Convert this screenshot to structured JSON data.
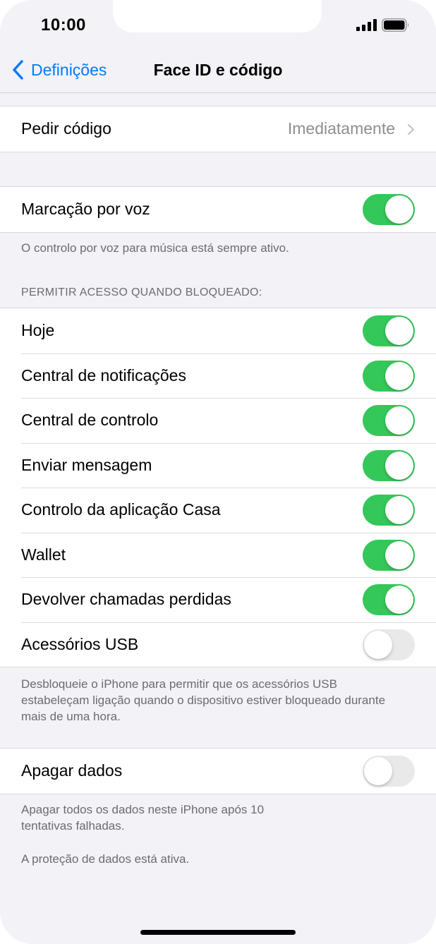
{
  "status": {
    "time": "10:00"
  },
  "nav": {
    "back_label": "Definições",
    "title": "Face ID e código"
  },
  "passcode": {
    "label": "Pedir código",
    "value": "Imediatamente"
  },
  "voice": {
    "label": "Marcação por voz",
    "enabled": true,
    "note": "O controlo por voz para música está sempre ativo."
  },
  "locked_access": {
    "header": "PERMITIR ACESSO QUANDO BLOQUEADO:",
    "items": [
      {
        "label": "Hoje",
        "enabled": true
      },
      {
        "label": "Central de notificações",
        "enabled": true
      },
      {
        "label": "Central de controlo",
        "enabled": true
      },
      {
        "label": "Enviar mensagem",
        "enabled": true
      },
      {
        "label": "Controlo da aplicação Casa",
        "enabled": true
      },
      {
        "label": "Wallet",
        "enabled": true
      },
      {
        "label": "Devolver chamadas perdidas",
        "enabled": true
      },
      {
        "label": "Acessórios USB",
        "enabled": false
      }
    ],
    "note": "Desbloqueie o iPhone para permitir que os acessórios USB estabeleçam ligação quando o dispositivo estiver bloqueado durante mais de uma hora."
  },
  "erase": {
    "label": "Apagar dados",
    "enabled": false,
    "note": "Apagar todos os dados neste iPhone após 10 tentativas falhadas.",
    "note2": "A proteção de dados está ativa."
  },
  "colors": {
    "accent": "#007aff",
    "switch_on": "#34c759",
    "switch_off": "#e9e9ea",
    "background": "#f2f2f7"
  }
}
